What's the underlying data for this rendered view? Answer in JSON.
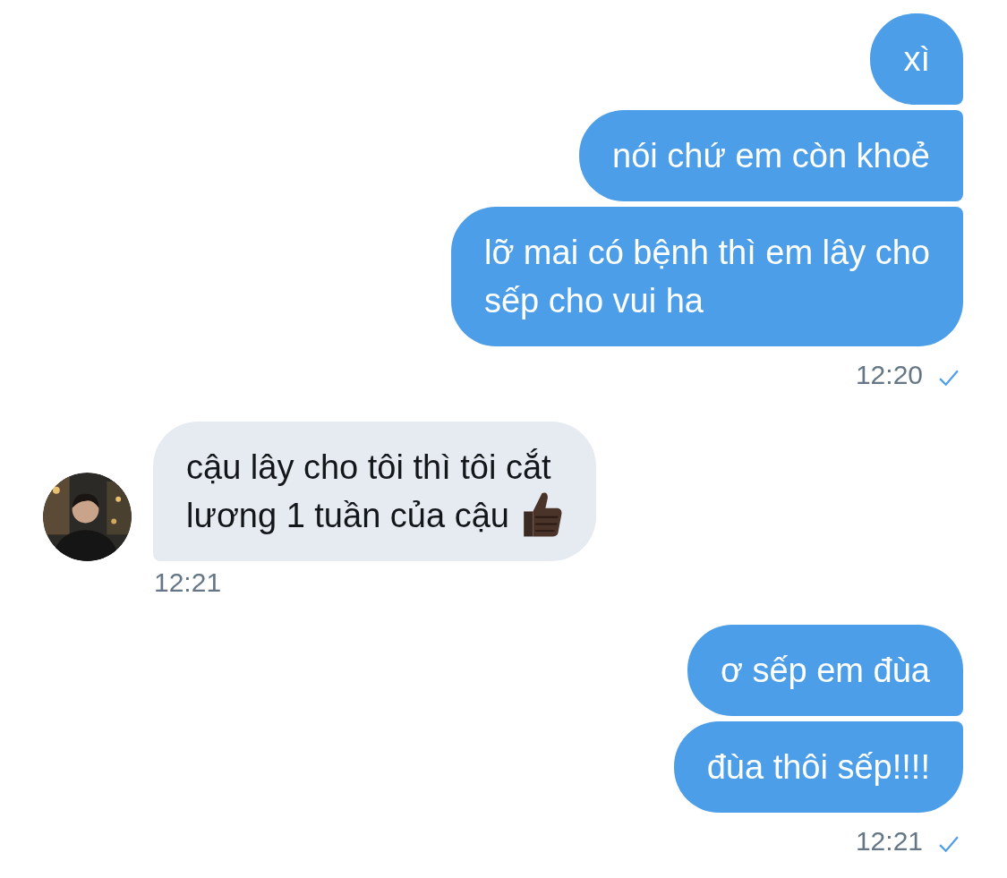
{
  "messages": [
    {
      "kind": "outgoing",
      "bubbles": [
        {
          "kind": "plain",
          "lines": [
            "xì"
          ]
        },
        {
          "kind": "plain",
          "lines": [
            "nói chứ em còn khoẻ"
          ]
        },
        {
          "kind": "plain",
          "lines": [
            "lỡ mai có bệnh thì em lây cho",
            "sếp cho vui ha"
          ]
        }
      ],
      "time": "12:20",
      "read": true
    },
    {
      "kind": "incoming",
      "bubbles": [
        {
          "kind": "thumbsup",
          "lines": [
            "cậu lây cho tôi thì tôi cắt",
            "lương 1 tuần của cậu"
          ]
        }
      ],
      "time": "12:21"
    },
    {
      "kind": "outgoing",
      "bubbles": [
        {
          "kind": "plain",
          "lines": [
            "ơ sếp em đùa"
          ]
        },
        {
          "kind": "plain",
          "lines": [
            "đùa thôi sếp!!!!"
          ]
        }
      ],
      "time": "12:21",
      "read": true
    }
  ]
}
